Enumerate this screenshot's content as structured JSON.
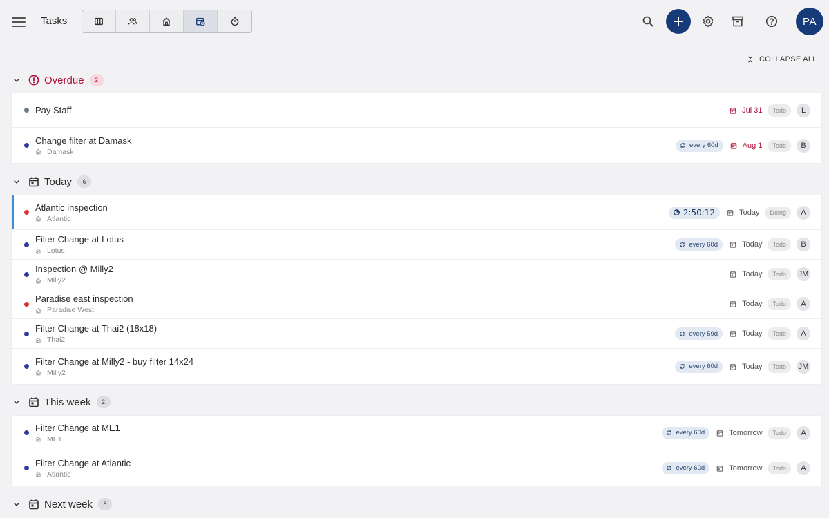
{
  "header": {
    "title": "Tasks",
    "views": [
      {
        "name": "board-view",
        "active": false
      },
      {
        "name": "people-view",
        "active": false
      },
      {
        "name": "property-view",
        "active": false
      },
      {
        "name": "schedule-view",
        "active": true
      },
      {
        "name": "timer-view",
        "active": false
      }
    ],
    "avatar_initials": "PA"
  },
  "collapse_all_label": "COLLAPSE ALL",
  "colors": {
    "accent": "#173b78",
    "overdue": "#b0123a",
    "dot_blue": "#2d3d9c",
    "dot_red": "#e03131",
    "dot_gray": "#6b7a86",
    "active_bar": "#3b8fd9"
  },
  "sections": {
    "overdue": {
      "title": "Overdue",
      "count": "2",
      "tasks": [
        {
          "title": "Pay Staff",
          "location": "",
          "dot": "gray",
          "repeat": "",
          "due": "Jul 31",
          "status": "Todo",
          "assignee": "L"
        },
        {
          "title": "Change filter at Damask",
          "location": "Damask",
          "dot": "blue",
          "repeat": "every 60d",
          "due": "Aug 1",
          "status": "Todo",
          "assignee": "B"
        }
      ]
    },
    "today": {
      "title": "Today",
      "count": "6",
      "tasks": [
        {
          "title": "Atlantic inspection",
          "location": "Atlantic",
          "dot": "red",
          "timer": "2:50:12",
          "due": "Today",
          "status": "Doing",
          "assignee": "A"
        },
        {
          "title": "Filter Change at Lotus",
          "location": "Lotus",
          "dot": "blue",
          "repeat": "every 60d",
          "due": "Today",
          "status": "Todo",
          "assignee": "B"
        },
        {
          "title": "Inspection @ Milly2",
          "location": "Milly2",
          "dot": "blue",
          "repeat": "",
          "due": "Today",
          "status": "Todo",
          "assignee": "JM"
        },
        {
          "title": "Paradise east inspection",
          "location": "Paradise West",
          "dot": "red",
          "repeat": "",
          "due": "Today",
          "status": "Todo",
          "assignee": "A"
        },
        {
          "title": "Filter Change at Thai2 (18x18)",
          "location": "Thai2",
          "dot": "blue",
          "repeat": "every 59d",
          "due": "Today",
          "status": "Todo",
          "assignee": "A"
        },
        {
          "title": "Filter Change at Milly2 - buy filter 14x24",
          "location": "Milly2",
          "dot": "blue",
          "repeat": "every 60d",
          "due": "Today",
          "status": "Todo",
          "assignee": "JM"
        }
      ]
    },
    "this_week": {
      "title": "This week",
      "count": "2",
      "tasks": [
        {
          "title": "Filter Change at ME1",
          "location": "ME1",
          "dot": "blue",
          "repeat": "every 60d",
          "due": "Tomorrow",
          "status": "Todo",
          "assignee": "A"
        },
        {
          "title": "Filter Change at Atlantic",
          "location": "Atlantic",
          "dot": "blue",
          "repeat": "every 60d",
          "due": "Tomorrow",
          "status": "Todo",
          "assignee": "A"
        }
      ]
    },
    "next_week": {
      "title": "Next week",
      "count": "8"
    }
  }
}
